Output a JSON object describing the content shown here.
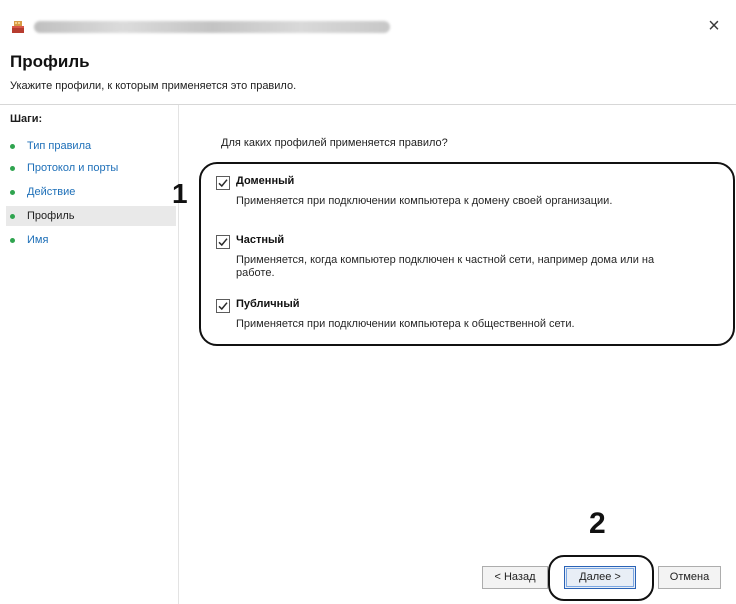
{
  "window": {
    "close_glyph": "×",
    "title_state": "blurred"
  },
  "header": {
    "title": "Профиль",
    "subtitle": "Укажите профили, к которым применяется это правило."
  },
  "sidebar": {
    "title": "Шаги:",
    "items": [
      {
        "label": "Тип правила",
        "active": false
      },
      {
        "label": "Протокол и порты",
        "active": false
      },
      {
        "label": "Действие",
        "active": false
      },
      {
        "label": "Профиль",
        "active": true
      },
      {
        "label": "Имя",
        "active": false
      }
    ]
  },
  "main": {
    "question": "Для каких профилей применяется правило?",
    "profiles": [
      {
        "name": "Доменный",
        "checked": true,
        "description": "Применяется при подключении компьютера к домену своей организации."
      },
      {
        "name": "Частный",
        "checked": true,
        "description": "Применяется, когда компьютер подключен к частной сети, например дома или на работе."
      },
      {
        "name": "Публичный",
        "checked": true,
        "description": "Применяется при подключении компьютера к общественной сети."
      }
    ]
  },
  "buttons": {
    "back": "< Назад",
    "next": "Далее >",
    "cancel": "Отмена"
  },
  "callouts": {
    "first": "1",
    "second": "2"
  },
  "colors": {
    "link": "#1d6fb8",
    "dot": "#2fa44f",
    "active_step": "#e9e9e9",
    "primary_border": "#2b63b6"
  },
  "icons": {
    "app": "firewall-app-icon",
    "close": "close-icon",
    "check": "check-icon",
    "step": "step-dot-icon"
  }
}
